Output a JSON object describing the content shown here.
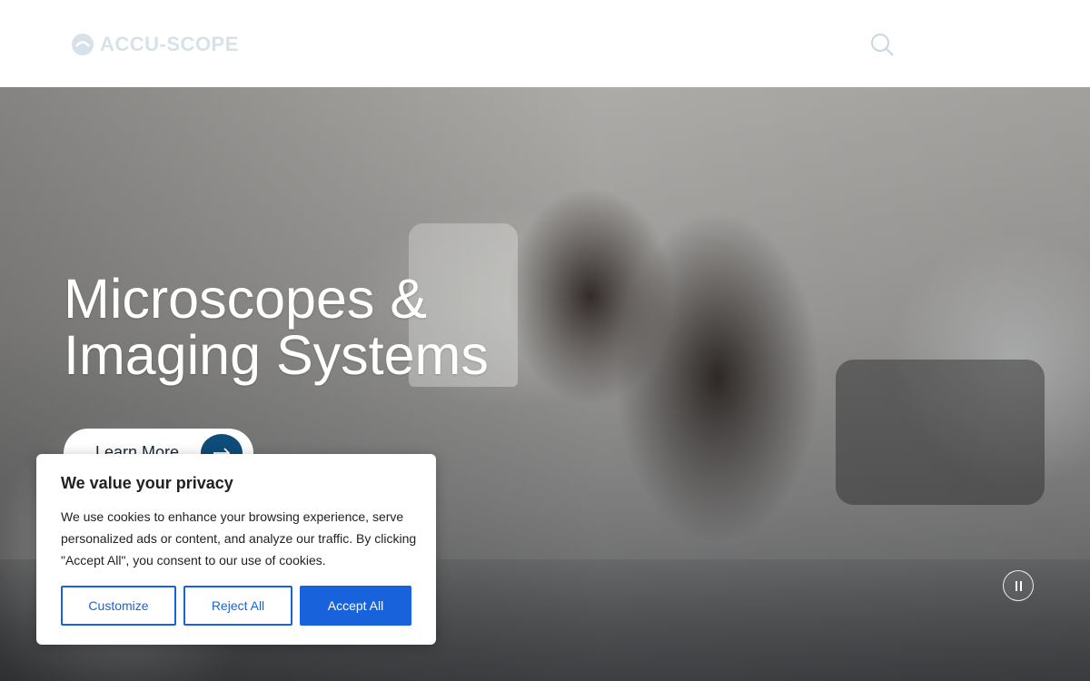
{
  "header": {
    "logo_text": "ACCU-SCOPE",
    "search_icon": "search-icon"
  },
  "hero": {
    "title_line1": "Microscopes &",
    "title_line2": "Imaging Systems",
    "cta_label": "Learn More",
    "cta_icon": "arrow-right-icon",
    "pause_icon": "pause-icon"
  },
  "cookie_banner": {
    "title": "We value your privacy",
    "body": "We use cookies to enhance your browsing experience, serve personalized ads or content, and analyze our traffic. By clicking \"Accept All\", you consent to our use of cookies.",
    "customize_label": "Customize",
    "reject_label": "Reject All",
    "accept_label": "Accept All"
  },
  "colors": {
    "brand": "#0e4c7a",
    "consent_accent": "#1863dc",
    "hero_text": "#ffffff"
  }
}
